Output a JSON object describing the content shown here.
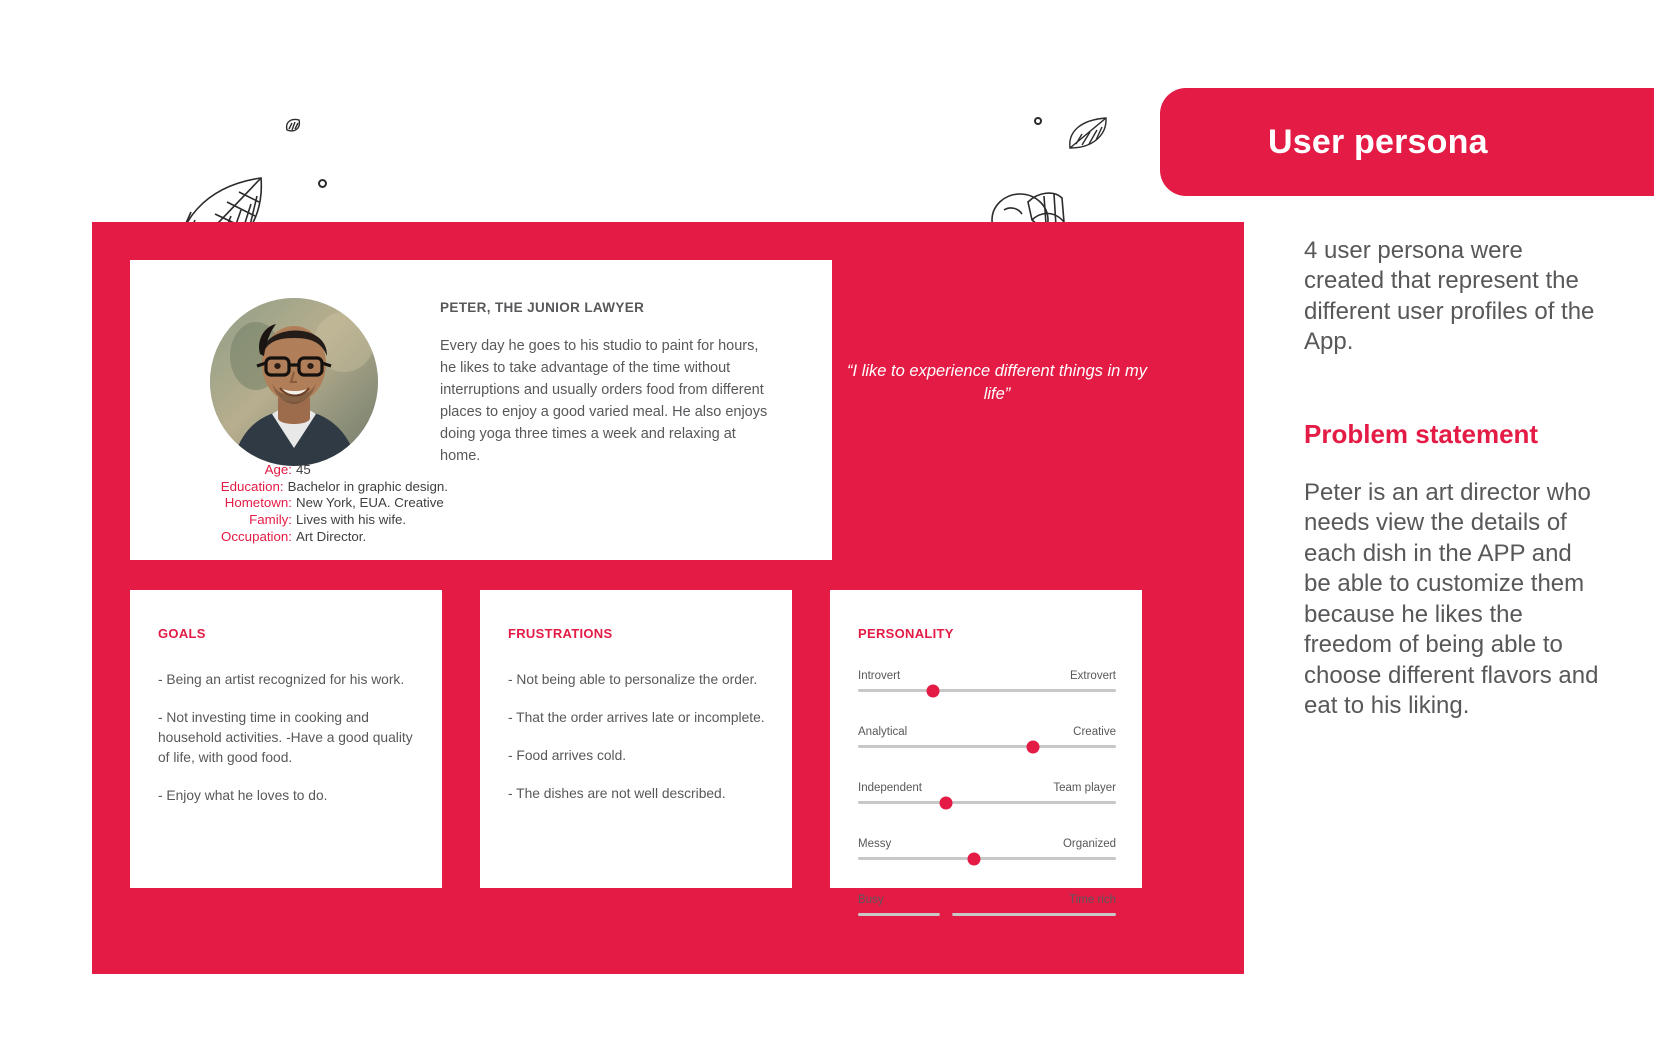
{
  "header": {
    "title": "User persona"
  },
  "persona": {
    "name": "PETER, THE JUNIOR LAWYER",
    "description": "Every day he goes to his studio to paint for hours, he likes to take advantage of the time without interruptions and usually orders food from different places to enjoy a good varied meal. He also enjoys doing yoga three times a week and relaxing at home.",
    "quote": "“I like to experience different things in my life”",
    "attributes": [
      {
        "label": "Age:",
        "value": "45"
      },
      {
        "label": "Education:",
        "value": "Bachelor in graphic design."
      },
      {
        "label": "Hometown:",
        "value": "New York, EUA. Creative"
      },
      {
        "label": "Family:",
        "value": "Lives with his wife."
      },
      {
        "label": "Occupation:",
        "value": "Art Director."
      }
    ]
  },
  "goals": {
    "title": "GOALS",
    "items": [
      "- Being an artist recognized for his work.",
      "- Not investing time in cooking and household activities. -Have a good quality of life, with good food.",
      "- Enjoy what he loves to do."
    ]
  },
  "frustrations": {
    "title": "FRUSTRATIONS",
    "items": [
      "- Not being able to personalize the order.",
      "- That the order arrives late or incomplete.",
      "- Food arrives cold.",
      "- The dishes are not well described."
    ]
  },
  "personality": {
    "title": "PERSONALITY",
    "sliders": [
      {
        "left_label": "Introvert",
        "right_label": "Extrovert",
        "value": 29
      },
      {
        "left_label": "Analytical",
        "right_label": "Creative",
        "value": 68
      },
      {
        "left_label": "Independent",
        "right_label": "Team player",
        "value": 34
      },
      {
        "left_label": "Messy",
        "right_label": "Organized",
        "value": 45
      },
      {
        "left_label": "Busy",
        "right_label": "Time rich",
        "value": 34
      }
    ]
  },
  "sidebar": {
    "intro": "4 user persona were created that represent the different user profiles of the App.",
    "problem_title": "Problem statement",
    "problem_text": "Peter is an art director who needs view the details of each dish in the APP and be able to customize them because he likes the freedom of being able to choose different flavors and eat to his liking."
  },
  "colors": {
    "accent": "#E31B45",
    "text": "#58585B",
    "white": "#FFFFFF"
  }
}
